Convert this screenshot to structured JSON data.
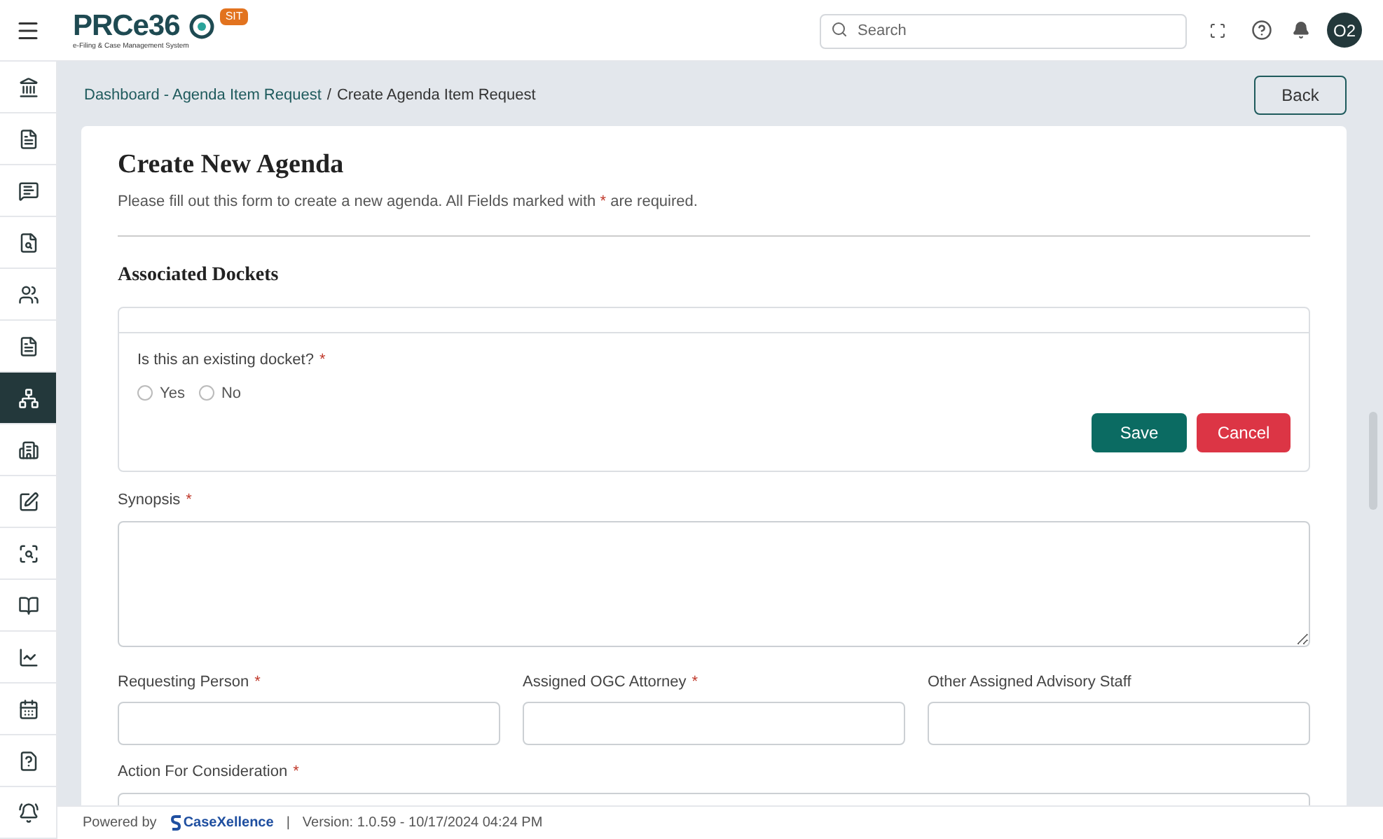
{
  "header": {
    "logo_text": "PRCe36",
    "logo_tagline": "e-Filing & Case Management System",
    "env_badge": "SIT",
    "search": {
      "placeholder": "Search"
    },
    "avatar": "O2"
  },
  "sidebar": {
    "items": [
      {
        "kind": "bank",
        "selected": false
      },
      {
        "kind": "document",
        "selected": false
      },
      {
        "kind": "chat",
        "selected": false
      },
      {
        "kind": "file-search",
        "selected": false
      },
      {
        "kind": "users",
        "selected": false
      },
      {
        "kind": "file-dollar",
        "selected": false
      },
      {
        "kind": "agenda",
        "selected": true
      },
      {
        "kind": "building",
        "selected": false
      },
      {
        "kind": "text",
        "selected": false
      },
      {
        "kind": "scan",
        "selected": false
      },
      {
        "kind": "book",
        "selected": false
      },
      {
        "kind": "chart",
        "selected": false
      },
      {
        "kind": "calendar",
        "selected": false
      },
      {
        "kind": "question",
        "selected": false
      },
      {
        "kind": "alarm",
        "selected": false
      }
    ]
  },
  "breadcrumb": {
    "link": "Dashboard - Agenda Item Request",
    "separator": "/",
    "current": "Create Agenda Item Request"
  },
  "back_button": "Back",
  "form": {
    "title": "Create New Agenda",
    "subtitle_before": "Please fill out this form to create a new agenda. All Fields marked with",
    "subtitle_mark": "*",
    "subtitle_after": "are required.",
    "section_title": "Associated Dockets",
    "docket_question": {
      "label": "Is this an existing docket?",
      "required_mark": "*",
      "options": [
        {
          "label": "Yes",
          "selected": false
        },
        {
          "label": "No",
          "selected": false
        }
      ]
    },
    "save": "Save",
    "cancel": "Cancel",
    "synopsis": {
      "label": "Synopsis",
      "required_mark": "*"
    },
    "fields": [
      {
        "label": "Requesting Person",
        "required_mark": "*"
      },
      {
        "label": "Assigned OGC Attorney",
        "required_mark": "*"
      },
      {
        "label": "Other Assigned Advisory Staff"
      }
    ],
    "action": {
      "label": "Action For Consideration",
      "required_mark": "*"
    }
  },
  "footer": {
    "powered_by": "Powered by",
    "brand": "CaseXellence",
    "separator": "|",
    "version": "Version: 1.0.59 - 10/17/2024 04:24 PM"
  }
}
